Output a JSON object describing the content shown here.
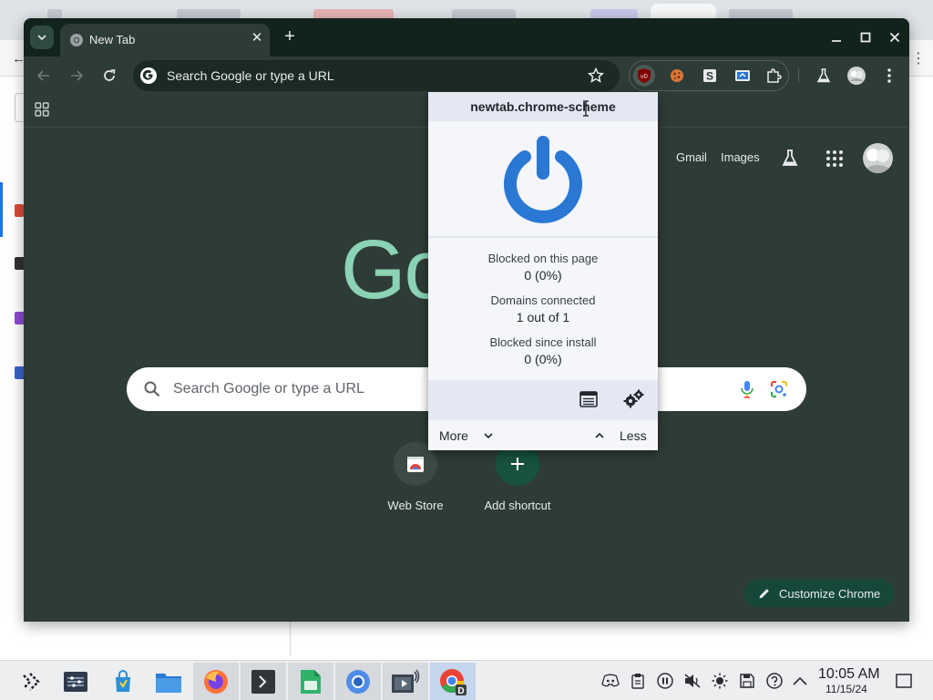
{
  "window": {
    "tab_title": "New Tab",
    "new_tab_label": "+"
  },
  "omnibox": {
    "text": "Search Google or type a URL"
  },
  "ntp": {
    "links": [
      "Gmail",
      "Images"
    ],
    "logo_text": "Go",
    "search_placeholder": "Search Google or type a URL",
    "shortcuts": [
      {
        "label": "Web Store"
      },
      {
        "label": "Add shortcut"
      }
    ],
    "customize_label": "Customize Chrome"
  },
  "ublock": {
    "hostname": "newtab.chrome-scheme",
    "stats": [
      {
        "label": "Blocked on this page",
        "value": "0 (0%)"
      },
      {
        "label": "Domains connected",
        "value": "1 out of 1"
      },
      {
        "label": "Blocked since install",
        "value": "0 (0%)"
      }
    ],
    "more_label": "More",
    "less_label": "Less",
    "icons": [
      "power-icon",
      "logger-icon",
      "dashboard-icon"
    ]
  },
  "taskbar": {
    "apps": [
      "app-launcher",
      "system-settings",
      "discover-store",
      "file-manager",
      "firefox",
      "terminal",
      "spreadsheet",
      "chromium",
      "media-player",
      "chrome"
    ],
    "tray": [
      "discord-icon",
      "clipboard-icon",
      "pause-icon",
      "mute-icon",
      "brightness-icon",
      "save-icon",
      "help-icon",
      "chevron-up-icon"
    ],
    "time": "10:05 AM",
    "date": "11/15/24"
  },
  "colors": {
    "window_bg": "#2e3c37",
    "titlebar": "#12221d",
    "accent_blue": "#2a77d4",
    "logo_green": "#8bd3b5",
    "customize_bg": "#16483a"
  }
}
